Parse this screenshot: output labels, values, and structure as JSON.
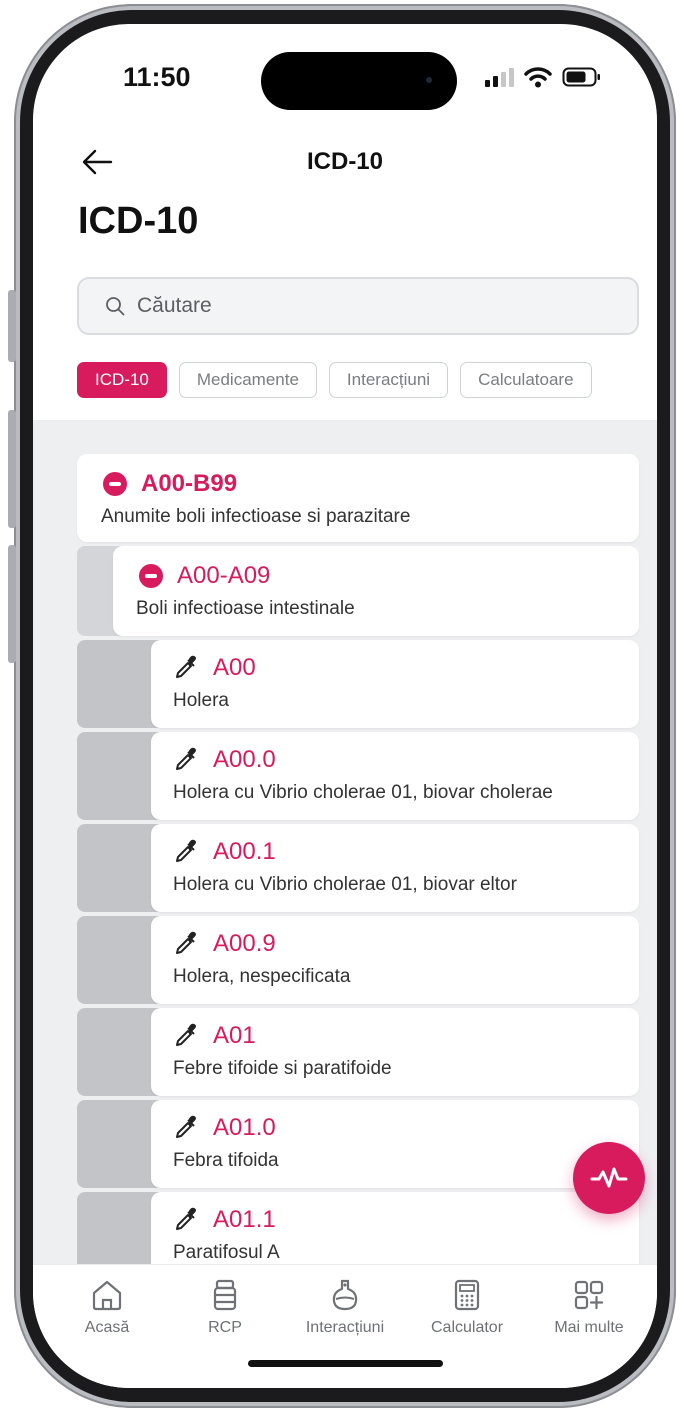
{
  "status_bar": {
    "time": "11:50"
  },
  "nav": {
    "title": "ICD-10"
  },
  "page": {
    "title": "ICD-10"
  },
  "search": {
    "placeholder": "Căutare"
  },
  "chips": [
    {
      "label": "ICD-10",
      "active": true
    },
    {
      "label": "Medicamente",
      "active": false
    },
    {
      "label": "Interacțiuni",
      "active": false
    },
    {
      "label": "Calculatoare",
      "active": false
    }
  ],
  "tree": {
    "chapter": {
      "code": "A00-B99",
      "description": "Anumite boli infectioase si parazitare"
    },
    "block": {
      "code": "A00-A09",
      "description": "Boli infectioase intestinale"
    },
    "items": [
      {
        "code": "A00",
        "description": "Holera"
      },
      {
        "code": "A00.0",
        "description": "Holera cu Vibrio cholerae 01, biovar cholerae"
      },
      {
        "code": "A00.1",
        "description": "Holera cu Vibrio cholerae 01, biovar eltor"
      },
      {
        "code": "A00.9",
        "description": "Holera, nespecificata"
      },
      {
        "code": "A01",
        "description": "Febre tifoide si paratifoide"
      },
      {
        "code": "A01.0",
        "description": "Febra tifoida"
      },
      {
        "code": "A01.1",
        "description": "Paratifosul A"
      }
    ]
  },
  "fab": {
    "icon": "pulse-icon"
  },
  "tabbar": [
    {
      "label": "Acasă",
      "icon": "home-icon"
    },
    {
      "label": "RCP",
      "icon": "pill-bottle-icon"
    },
    {
      "label": "Interacțiuni",
      "icon": "flask-icon"
    },
    {
      "label": "Calculator",
      "icon": "calculator-icon"
    },
    {
      "label": "Mai multe",
      "icon": "grid-plus-icon"
    }
  ],
  "colors": {
    "accent": "#d81b5c",
    "text": "#333333",
    "list_bg": "#eeeff1"
  }
}
